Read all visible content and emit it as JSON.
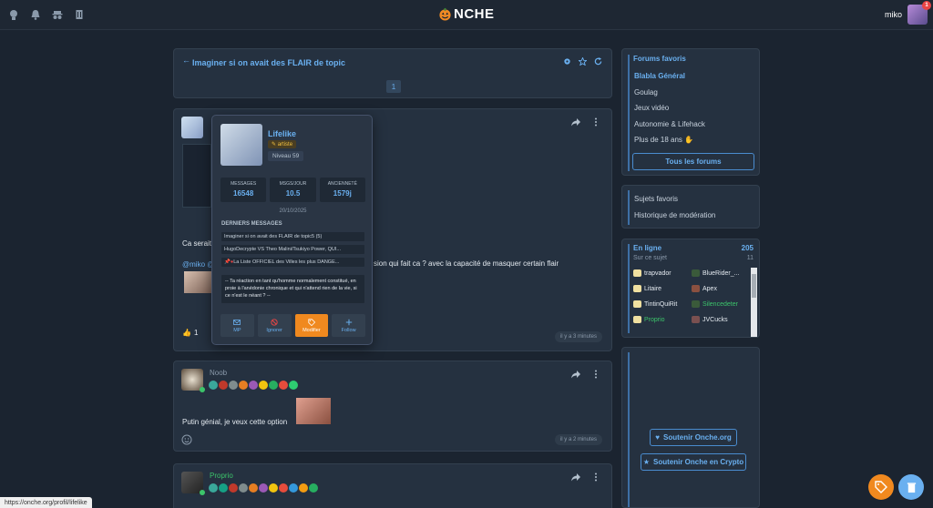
{
  "header": {
    "logo_text": "NCHE",
    "username": "miko",
    "notif_count": "1"
  },
  "topic": {
    "title": "Imaginer si on avait des FLAIR de topic",
    "page": "1"
  },
  "post1": {
    "text_left": "Ca serait",
    "text_right": "sion qui fait ca ? avec la capacité de masquer certain flair",
    "mention": "@miko @",
    "likes": "1",
    "time": "il y a 3 minutes"
  },
  "post2": {
    "author": "Noob",
    "text": "Putin génial, je veux cette option",
    "time": "il y a 2 minutes"
  },
  "post3": {
    "author": "Proprio"
  },
  "popover": {
    "name": "Lifelike",
    "tag": "artiste",
    "level": "Niveau 59",
    "stats": [
      {
        "label": "MESSAGES",
        "value": "16548"
      },
      {
        "label": "MSGS/JOUR",
        "value": "10.5"
      },
      {
        "label": "ANCIENNETÉ",
        "value": "1579j"
      }
    ],
    "date": "20/10/2025",
    "section": "DERNIERS MESSAGES",
    "messages": [
      "Imaginer si on avait des FLAIR de topic5 (5)",
      "HugoDecrypte VS Theo Malini/Tsukiyo Power, QUI...",
      "La Liste OFFICIEL des Villes les plus DANGE..."
    ],
    "quote": "-- Ta réaction en tant qu'homme normalement constitué, en proie à l'anédonie chronique et qui n'attend rien de la vie, si ce n'est le néant ? --",
    "buttons": {
      "mp": "MP",
      "ignore": "Ignorer",
      "edit": "Modifier",
      "follow": "Follow"
    }
  },
  "sidebar": {
    "fav_title": "Forums favoris",
    "forums": [
      "Blabla Général",
      "Goulag",
      "Jeux vidéo",
      "Autonomie & Lifehack",
      "Plus de 18 ans"
    ],
    "all_forums": "Tous les forums",
    "links": [
      "Sujets favoris",
      "Historique de modération"
    ],
    "online_title": "En ligne",
    "online_count": "205",
    "on_topic": "Sur ce sujet",
    "on_topic_count": "11",
    "users": [
      "trapvador",
      "BlueRider_...",
      "Litaire",
      "Apex",
      "TintinQuiRit",
      "Silencedeter",
      "Proprio",
      "JVCucks"
    ],
    "support": "Soutenir Onche.org",
    "support_crypto": "Soutenir Onche en Crypto"
  },
  "status_url": "https://onche.org/profil/lifelike",
  "colors": {
    "accent": "#6ab0f0",
    "orange": "#f0891f",
    "bg": "#1b2430"
  }
}
